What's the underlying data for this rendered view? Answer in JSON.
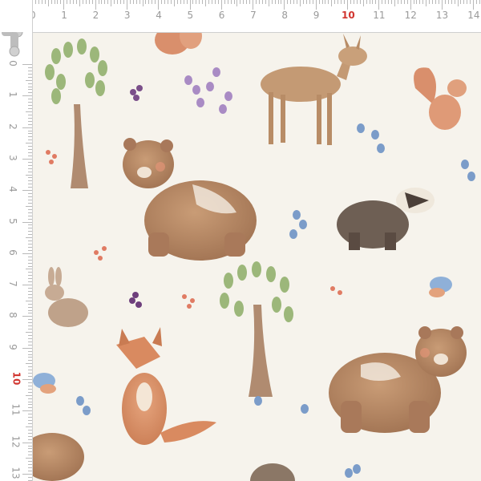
{
  "ruler": {
    "top_numbers": [
      "0",
      "1",
      "2",
      "3",
      "4",
      "5",
      "6",
      "7",
      "8",
      "9",
      "10",
      "11",
      "12",
      "13",
      "14"
    ],
    "left_numbers": [
      "0",
      "1",
      "2",
      "3",
      "4",
      "5",
      "6",
      "7",
      "8",
      "9",
      "10",
      "11",
      "12",
      "13"
    ],
    "highlight_number": "10",
    "highlight_color": "#d1352f",
    "tick_color": "#b9b9b9",
    "number_color": "#9a9a9a"
  },
  "fabric": {
    "background_color": "#f6f3ec",
    "motifs": [
      "bear",
      "deer",
      "squirrel",
      "badger",
      "rabbit",
      "fox",
      "bird",
      "tree",
      "bluebell",
      "lavender",
      "berry-sprig",
      "hedgehog"
    ]
  }
}
